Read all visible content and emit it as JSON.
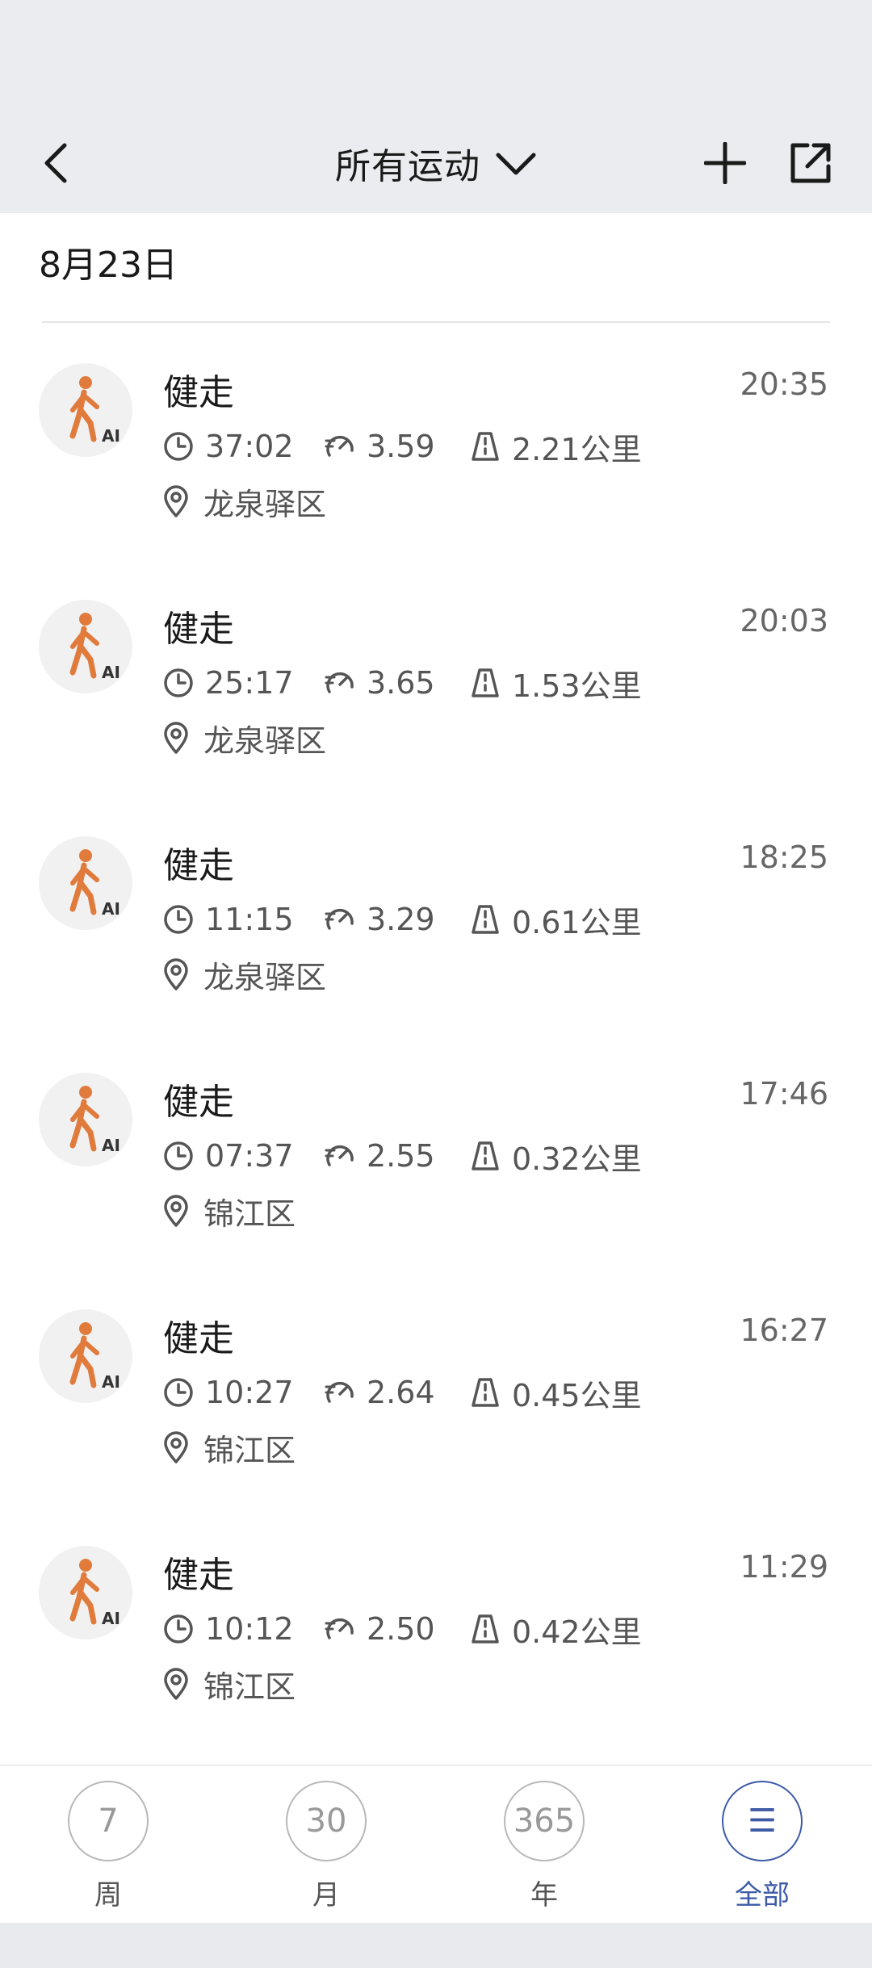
{
  "header": {
    "title": "所有运动"
  },
  "date_header": "8月23日",
  "records": [
    {
      "type": "健走",
      "time": "20:35",
      "duration": "37:02",
      "pace": "3.59",
      "distance": "2.21公里",
      "location": "龙泉驿区",
      "badge": "AI"
    },
    {
      "type": "健走",
      "time": "20:03",
      "duration": "25:17",
      "pace": "3.65",
      "distance": "1.53公里",
      "location": "龙泉驿区",
      "badge": "AI"
    },
    {
      "type": "健走",
      "time": "18:25",
      "duration": "11:15",
      "pace": "3.29",
      "distance": "0.61公里",
      "location": "龙泉驿区",
      "badge": "AI"
    },
    {
      "type": "健走",
      "time": "17:46",
      "duration": "07:37",
      "pace": "2.55",
      "distance": "0.32公里",
      "location": "锦江区",
      "badge": "AI"
    },
    {
      "type": "健走",
      "time": "16:27",
      "duration": "10:27",
      "pace": "2.64",
      "distance": "0.45公里",
      "location": "锦江区",
      "badge": "AI"
    },
    {
      "type": "健走",
      "time": "11:29",
      "duration": "10:12",
      "pace": "2.50",
      "distance": "0.42公里",
      "location": "锦江区",
      "badge": "AI"
    }
  ],
  "bottom_nav": [
    {
      "circle": "7",
      "label": "周"
    },
    {
      "circle": "30",
      "label": "月"
    },
    {
      "circle": "365",
      "label": "年"
    },
    {
      "circle": "☰",
      "label": "全部"
    }
  ],
  "colors": {
    "accent": "#3c5aa6",
    "walker_icon": "#e07b3c",
    "header_bg": "#ebecef"
  }
}
